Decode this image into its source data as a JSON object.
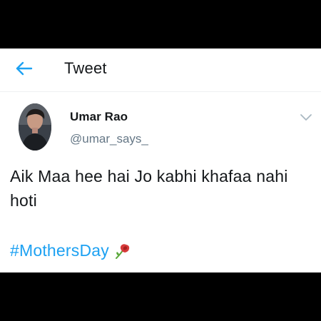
{
  "header": {
    "title": "Tweet",
    "back_icon": "arrow-left-icon"
  },
  "tweet": {
    "author_name": "Umar Rao",
    "author_handle": "@umar_says_",
    "text": "Aik Maa hee hai Jo kabhi khafaa nahi hoti",
    "hashtag": "#MothersDay",
    "emoji_icon": "rose-icon"
  },
  "colors": {
    "accent": "#1da1f2",
    "text": "#14171a",
    "muted": "#657786",
    "background": "#ffffff",
    "frame": "#000000"
  }
}
